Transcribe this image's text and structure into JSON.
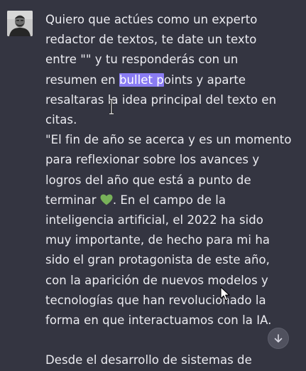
{
  "message": {
    "lines": [
      "Quiero que actúes como un experto",
      "redactor de textos, te date un texto",
      "entre \"\" y tu responderás con un",
      "resumen en ",
      "bullet p",
      "oints y aparte",
      "resaltaras ",
      "l",
      "a idea principal del texto en",
      "citas.",
      "\"El fin de año se acerca y es un momento",
      "para reflexionar sobre los avances y",
      "logros del año que está a punto de",
      "terminar ",
      ". En el campo de la",
      "inteligencia artificial, el 2022 ha sido",
      "muy importante, de hecho para mi ha",
      "sido el gran protagonista de este año,",
      "con la aparición de nuevos modelos y",
      "tecnologías que han revolucionado la",
      "forma en que interactuamos con la IA.",
      "Desde el desarrollo de sistemas de"
    ]
  },
  "icons": {
    "avatar": "user-avatar",
    "heart": "green-heart-emoji",
    "scroll": "arrow-down-icon",
    "text_cursor": "i-beam-cursor",
    "pointer": "mouse-pointer-cursor"
  },
  "colors": {
    "background": "#343541",
    "text": "#ececf1",
    "selection": "#8a7cf3",
    "heart": "#78b159"
  }
}
